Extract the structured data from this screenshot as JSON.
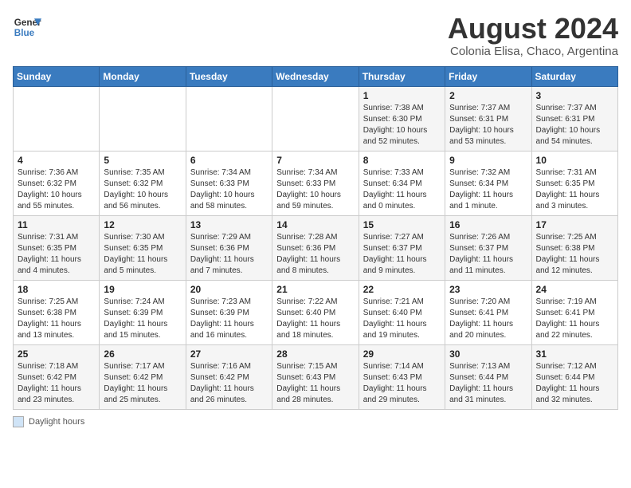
{
  "header": {
    "logo_line1": "General",
    "logo_line2": "Blue",
    "month": "August 2024",
    "location": "Colonia Elisa, Chaco, Argentina"
  },
  "days_of_week": [
    "Sunday",
    "Monday",
    "Tuesday",
    "Wednesday",
    "Thursday",
    "Friday",
    "Saturday"
  ],
  "weeks": [
    [
      {
        "day": "",
        "info": ""
      },
      {
        "day": "",
        "info": ""
      },
      {
        "day": "",
        "info": ""
      },
      {
        "day": "",
        "info": ""
      },
      {
        "day": "1",
        "info": "Sunrise: 7:38 AM\nSunset: 6:30 PM\nDaylight: 10 hours and 52 minutes."
      },
      {
        "day": "2",
        "info": "Sunrise: 7:37 AM\nSunset: 6:31 PM\nDaylight: 10 hours and 53 minutes."
      },
      {
        "day": "3",
        "info": "Sunrise: 7:37 AM\nSunset: 6:31 PM\nDaylight: 10 hours and 54 minutes."
      }
    ],
    [
      {
        "day": "4",
        "info": "Sunrise: 7:36 AM\nSunset: 6:32 PM\nDaylight: 10 hours and 55 minutes."
      },
      {
        "day": "5",
        "info": "Sunrise: 7:35 AM\nSunset: 6:32 PM\nDaylight: 10 hours and 56 minutes."
      },
      {
        "day": "6",
        "info": "Sunrise: 7:34 AM\nSunset: 6:33 PM\nDaylight: 10 hours and 58 minutes."
      },
      {
        "day": "7",
        "info": "Sunrise: 7:34 AM\nSunset: 6:33 PM\nDaylight: 10 hours and 59 minutes."
      },
      {
        "day": "8",
        "info": "Sunrise: 7:33 AM\nSunset: 6:34 PM\nDaylight: 11 hours and 0 minutes."
      },
      {
        "day": "9",
        "info": "Sunrise: 7:32 AM\nSunset: 6:34 PM\nDaylight: 11 hours and 1 minute."
      },
      {
        "day": "10",
        "info": "Sunrise: 7:31 AM\nSunset: 6:35 PM\nDaylight: 11 hours and 3 minutes."
      }
    ],
    [
      {
        "day": "11",
        "info": "Sunrise: 7:31 AM\nSunset: 6:35 PM\nDaylight: 11 hours and 4 minutes."
      },
      {
        "day": "12",
        "info": "Sunrise: 7:30 AM\nSunset: 6:35 PM\nDaylight: 11 hours and 5 minutes."
      },
      {
        "day": "13",
        "info": "Sunrise: 7:29 AM\nSunset: 6:36 PM\nDaylight: 11 hours and 7 minutes."
      },
      {
        "day": "14",
        "info": "Sunrise: 7:28 AM\nSunset: 6:36 PM\nDaylight: 11 hours and 8 minutes."
      },
      {
        "day": "15",
        "info": "Sunrise: 7:27 AM\nSunset: 6:37 PM\nDaylight: 11 hours and 9 minutes."
      },
      {
        "day": "16",
        "info": "Sunrise: 7:26 AM\nSunset: 6:37 PM\nDaylight: 11 hours and 11 minutes."
      },
      {
        "day": "17",
        "info": "Sunrise: 7:25 AM\nSunset: 6:38 PM\nDaylight: 11 hours and 12 minutes."
      }
    ],
    [
      {
        "day": "18",
        "info": "Sunrise: 7:25 AM\nSunset: 6:38 PM\nDaylight: 11 hours and 13 minutes."
      },
      {
        "day": "19",
        "info": "Sunrise: 7:24 AM\nSunset: 6:39 PM\nDaylight: 11 hours and 15 minutes."
      },
      {
        "day": "20",
        "info": "Sunrise: 7:23 AM\nSunset: 6:39 PM\nDaylight: 11 hours and 16 minutes."
      },
      {
        "day": "21",
        "info": "Sunrise: 7:22 AM\nSunset: 6:40 PM\nDaylight: 11 hours and 18 minutes."
      },
      {
        "day": "22",
        "info": "Sunrise: 7:21 AM\nSunset: 6:40 PM\nDaylight: 11 hours and 19 minutes."
      },
      {
        "day": "23",
        "info": "Sunrise: 7:20 AM\nSunset: 6:41 PM\nDaylight: 11 hours and 20 minutes."
      },
      {
        "day": "24",
        "info": "Sunrise: 7:19 AM\nSunset: 6:41 PM\nDaylight: 11 hours and 22 minutes."
      }
    ],
    [
      {
        "day": "25",
        "info": "Sunrise: 7:18 AM\nSunset: 6:42 PM\nDaylight: 11 hours and 23 minutes."
      },
      {
        "day": "26",
        "info": "Sunrise: 7:17 AM\nSunset: 6:42 PM\nDaylight: 11 hours and 25 minutes."
      },
      {
        "day": "27",
        "info": "Sunrise: 7:16 AM\nSunset: 6:42 PM\nDaylight: 11 hours and 26 minutes."
      },
      {
        "day": "28",
        "info": "Sunrise: 7:15 AM\nSunset: 6:43 PM\nDaylight: 11 hours and 28 minutes."
      },
      {
        "day": "29",
        "info": "Sunrise: 7:14 AM\nSunset: 6:43 PM\nDaylight: 11 hours and 29 minutes."
      },
      {
        "day": "30",
        "info": "Sunrise: 7:13 AM\nSunset: 6:44 PM\nDaylight: 11 hours and 31 minutes."
      },
      {
        "day": "31",
        "info": "Sunrise: 7:12 AM\nSunset: 6:44 PM\nDaylight: 11 hours and 32 minutes."
      }
    ]
  ],
  "footer": {
    "legend_label": "Daylight hours"
  }
}
